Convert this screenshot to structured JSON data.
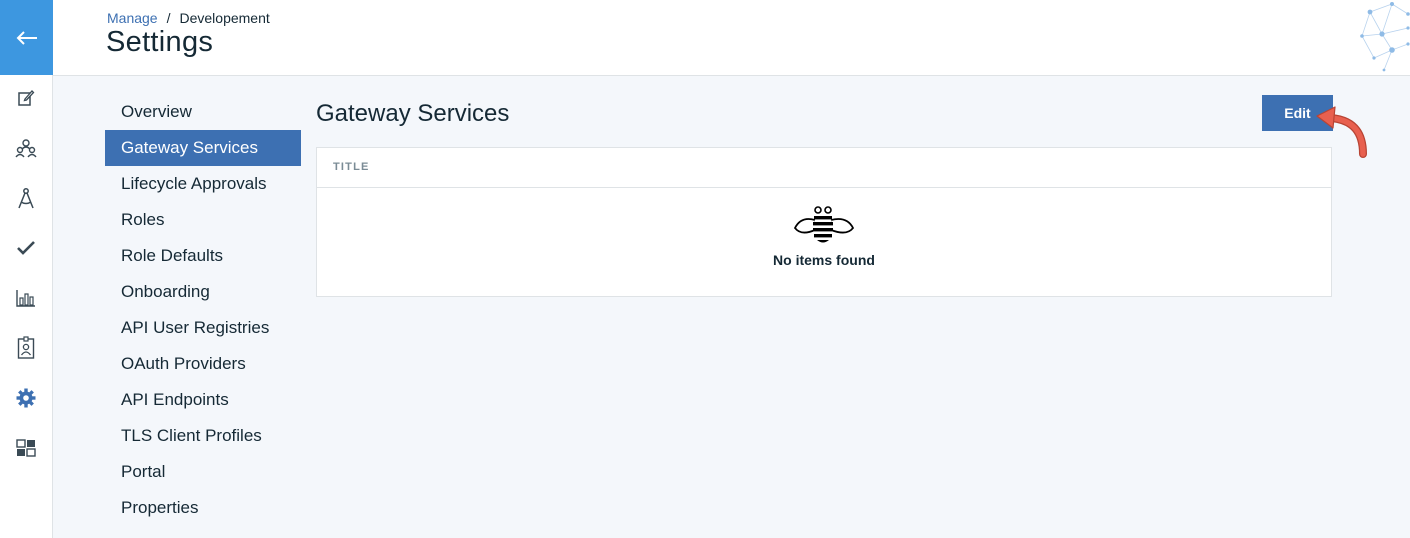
{
  "rail": {
    "icons": [
      "back-arrow-icon",
      "edit-icon",
      "people-icon",
      "compass-icon",
      "checkmark-icon",
      "bar-chart-icon",
      "badge-icon",
      "gear-icon",
      "dashboard-grid-icon"
    ],
    "accent_color": "#3d97e0",
    "active_icon": "gear-icon"
  },
  "breadcrumb": {
    "parent": "Manage",
    "separator": "/",
    "current": "Developement"
  },
  "page_title": "Settings",
  "subnav": {
    "items": [
      {
        "label": "Overview"
      },
      {
        "label": "Gateway Services"
      },
      {
        "label": "Lifecycle Approvals"
      },
      {
        "label": "Roles"
      },
      {
        "label": "Role Defaults"
      },
      {
        "label": "Onboarding"
      },
      {
        "label": "API User Registries"
      },
      {
        "label": "OAuth Providers"
      },
      {
        "label": "API Endpoints"
      },
      {
        "label": "TLS Client Profiles"
      },
      {
        "label": "Portal"
      },
      {
        "label": "Properties"
      }
    ],
    "active_index": 1,
    "active_color": "#3d70b2"
  },
  "section": {
    "title": "Gateway Services",
    "edit_label": "Edit",
    "table": {
      "columns": [
        "TITLE"
      ],
      "rows": [],
      "empty_icon": "bee-icon",
      "empty_text": "No items found"
    }
  },
  "colors": {
    "primary": "#3d70b2",
    "background": "#f4f7fb",
    "annotation_arrow": "#e8604f"
  }
}
